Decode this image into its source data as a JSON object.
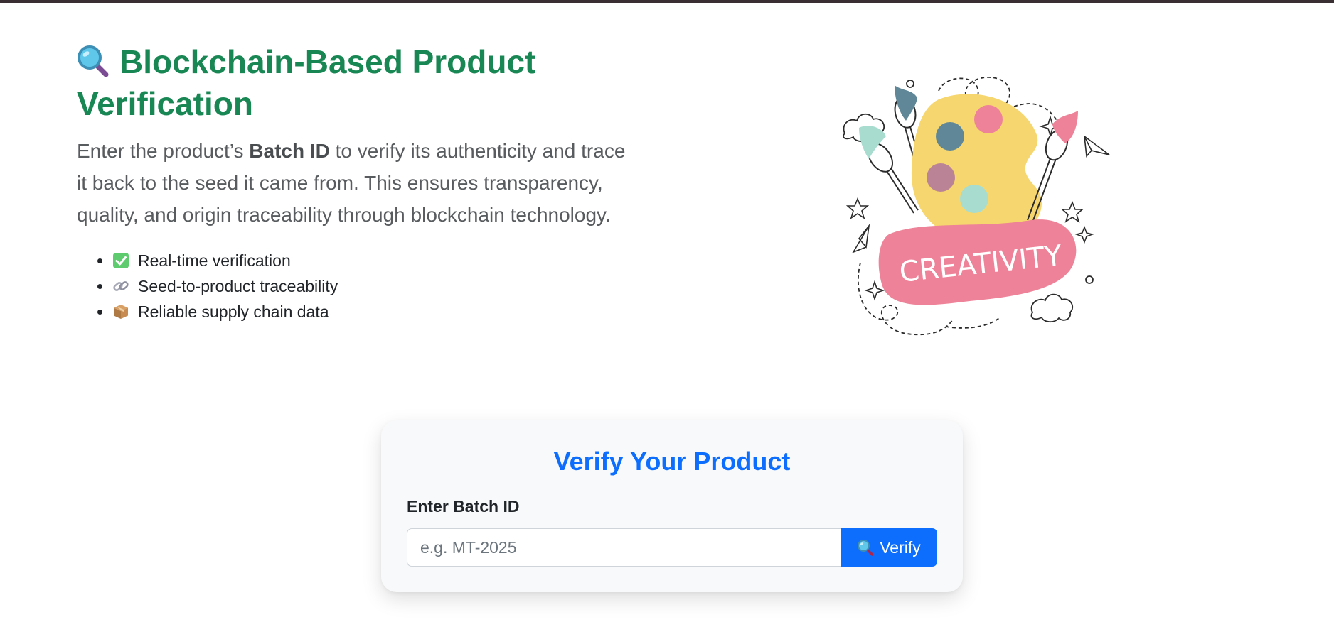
{
  "hero": {
    "title": "Blockchain-Based Product Verification",
    "title_icon": "magnifying-glass-icon",
    "intro_before": "Enter the product’s ",
    "intro_bold": "Batch ID",
    "intro_after": " to verify its authenticity and trace it back to the seed it came from. This ensures transparency, quality, and origin traceability through blockchain technology.",
    "features": [
      {
        "icon": "check-mark-icon",
        "label": "Real-time verification"
      },
      {
        "icon": "link-icon",
        "label": "Seed-to-product traceability"
      },
      {
        "icon": "package-icon",
        "label": "Reliable supply chain data"
      }
    ]
  },
  "illustration": {
    "text": "CREATIVITY"
  },
  "verify_card": {
    "title": "Verify Your Product",
    "label": "Enter Batch ID",
    "input_value": "",
    "input_placeholder": "e.g. MT-2025",
    "button_label": "Verify",
    "button_icon": "magnifying-glass-icon"
  },
  "colors": {
    "title_green": "#198754",
    "primary_blue": "#0d6efd",
    "card_bg": "#f8f9fa",
    "banner_pink": "#ee8298",
    "palette_yellow": "#f6d66e"
  }
}
